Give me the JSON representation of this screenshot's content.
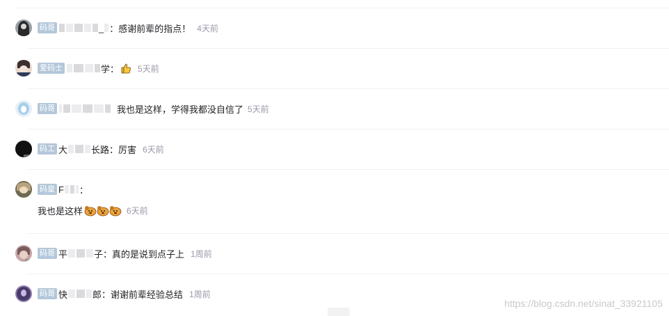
{
  "comments": [
    {
      "badge": "码哥",
      "name_prefix": "",
      "name_suffix": "_",
      "sep": "：",
      "text": "感谢前辈的指点！",
      "time": "4天前",
      "avatar_colors": [
        "#2a2a2a",
        "#9aa0a6"
      ]
    },
    {
      "badge": "爱码士",
      "name_prefix": "",
      "name_suffix": "学",
      "sep": "：",
      "text": "",
      "time": "5天前",
      "avatar_colors": [
        "#3b2f2f",
        "#e9d8cf"
      ]
    },
    {
      "badge": "码哥",
      "name_prefix": "",
      "name_suffix": "",
      "sep": "",
      "text": "我也是这样，学得我都没自信了",
      "time": "5天前",
      "avatar_colors": [
        "#a8cfe8",
        "#e6f0f7"
      ]
    },
    {
      "badge": "码工",
      "name_prefix": "大",
      "name_suffix": "长路",
      "sep": "：",
      "text": "厉害",
      "time": "6天前",
      "avatar_colors": [
        "#111111",
        "#555555"
      ]
    },
    {
      "badge": "码皇",
      "name_prefix": "F",
      "name_suffix": "",
      "sep": "：",
      "text": "我也是这样",
      "time": "6天前",
      "avatar_colors": [
        "#b9a37e",
        "#6d6a52"
      ]
    },
    {
      "badge": "码哥",
      "name_prefix": "平",
      "name_suffix": "子",
      "sep": "：",
      "text": "真的是说到点子上",
      "time": "1周前",
      "avatar_colors": [
        "#7a5a5a",
        "#c5a6a6"
      ]
    },
    {
      "badge": "码哥",
      "name_prefix": "快",
      "name_suffix": "郎",
      "sep": "：",
      "text": "谢谢前辈经验总结",
      "time": "1周前",
      "avatar_colors": [
        "#4a3a6a",
        "#8e7fb0"
      ]
    }
  ],
  "icons": {
    "thumb": "thumbs-up-icon",
    "dog": "dog-emoji-icon"
  },
  "watermark": "https://blog.csdn.net/sinat_33921105"
}
